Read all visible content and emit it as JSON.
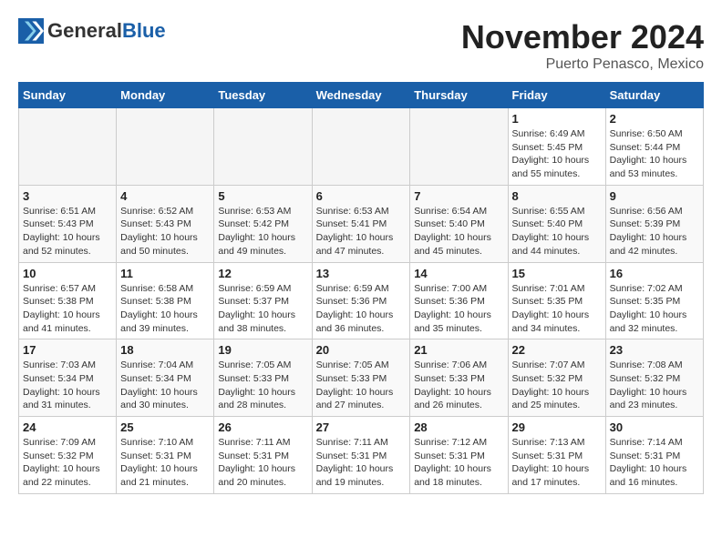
{
  "logo": {
    "text1": "General",
    "text2": "Blue"
  },
  "header": {
    "month": "November 2024",
    "location": "Puerto Penasco, Mexico"
  },
  "weekdays": [
    "Sunday",
    "Monday",
    "Tuesday",
    "Wednesday",
    "Thursday",
    "Friday",
    "Saturday"
  ],
  "weeks": [
    [
      {
        "day": "",
        "info": ""
      },
      {
        "day": "",
        "info": ""
      },
      {
        "day": "",
        "info": ""
      },
      {
        "day": "",
        "info": ""
      },
      {
        "day": "",
        "info": ""
      },
      {
        "day": "1",
        "sunrise": "Sunrise: 6:49 AM",
        "sunset": "Sunset: 5:45 PM",
        "daylight": "Daylight: 10 hours and 55 minutes."
      },
      {
        "day": "2",
        "sunrise": "Sunrise: 6:50 AM",
        "sunset": "Sunset: 5:44 PM",
        "daylight": "Daylight: 10 hours and 53 minutes."
      }
    ],
    [
      {
        "day": "3",
        "sunrise": "Sunrise: 6:51 AM",
        "sunset": "Sunset: 5:43 PM",
        "daylight": "Daylight: 10 hours and 52 minutes."
      },
      {
        "day": "4",
        "sunrise": "Sunrise: 6:52 AM",
        "sunset": "Sunset: 5:43 PM",
        "daylight": "Daylight: 10 hours and 50 minutes."
      },
      {
        "day": "5",
        "sunrise": "Sunrise: 6:53 AM",
        "sunset": "Sunset: 5:42 PM",
        "daylight": "Daylight: 10 hours and 49 minutes."
      },
      {
        "day": "6",
        "sunrise": "Sunrise: 6:53 AM",
        "sunset": "Sunset: 5:41 PM",
        "daylight": "Daylight: 10 hours and 47 minutes."
      },
      {
        "day": "7",
        "sunrise": "Sunrise: 6:54 AM",
        "sunset": "Sunset: 5:40 PM",
        "daylight": "Daylight: 10 hours and 45 minutes."
      },
      {
        "day": "8",
        "sunrise": "Sunrise: 6:55 AM",
        "sunset": "Sunset: 5:40 PM",
        "daylight": "Daylight: 10 hours and 44 minutes."
      },
      {
        "day": "9",
        "sunrise": "Sunrise: 6:56 AM",
        "sunset": "Sunset: 5:39 PM",
        "daylight": "Daylight: 10 hours and 42 minutes."
      }
    ],
    [
      {
        "day": "10",
        "sunrise": "Sunrise: 6:57 AM",
        "sunset": "Sunset: 5:38 PM",
        "daylight": "Daylight: 10 hours and 41 minutes."
      },
      {
        "day": "11",
        "sunrise": "Sunrise: 6:58 AM",
        "sunset": "Sunset: 5:38 PM",
        "daylight": "Daylight: 10 hours and 39 minutes."
      },
      {
        "day": "12",
        "sunrise": "Sunrise: 6:59 AM",
        "sunset": "Sunset: 5:37 PM",
        "daylight": "Daylight: 10 hours and 38 minutes."
      },
      {
        "day": "13",
        "sunrise": "Sunrise: 6:59 AM",
        "sunset": "Sunset: 5:36 PM",
        "daylight": "Daylight: 10 hours and 36 minutes."
      },
      {
        "day": "14",
        "sunrise": "Sunrise: 7:00 AM",
        "sunset": "Sunset: 5:36 PM",
        "daylight": "Daylight: 10 hours and 35 minutes."
      },
      {
        "day": "15",
        "sunrise": "Sunrise: 7:01 AM",
        "sunset": "Sunset: 5:35 PM",
        "daylight": "Daylight: 10 hours and 34 minutes."
      },
      {
        "day": "16",
        "sunrise": "Sunrise: 7:02 AM",
        "sunset": "Sunset: 5:35 PM",
        "daylight": "Daylight: 10 hours and 32 minutes."
      }
    ],
    [
      {
        "day": "17",
        "sunrise": "Sunrise: 7:03 AM",
        "sunset": "Sunset: 5:34 PM",
        "daylight": "Daylight: 10 hours and 31 minutes."
      },
      {
        "day": "18",
        "sunrise": "Sunrise: 7:04 AM",
        "sunset": "Sunset: 5:34 PM",
        "daylight": "Daylight: 10 hours and 30 minutes."
      },
      {
        "day": "19",
        "sunrise": "Sunrise: 7:05 AM",
        "sunset": "Sunset: 5:33 PM",
        "daylight": "Daylight: 10 hours and 28 minutes."
      },
      {
        "day": "20",
        "sunrise": "Sunrise: 7:05 AM",
        "sunset": "Sunset: 5:33 PM",
        "daylight": "Daylight: 10 hours and 27 minutes."
      },
      {
        "day": "21",
        "sunrise": "Sunrise: 7:06 AM",
        "sunset": "Sunset: 5:33 PM",
        "daylight": "Daylight: 10 hours and 26 minutes."
      },
      {
        "day": "22",
        "sunrise": "Sunrise: 7:07 AM",
        "sunset": "Sunset: 5:32 PM",
        "daylight": "Daylight: 10 hours and 25 minutes."
      },
      {
        "day": "23",
        "sunrise": "Sunrise: 7:08 AM",
        "sunset": "Sunset: 5:32 PM",
        "daylight": "Daylight: 10 hours and 23 minutes."
      }
    ],
    [
      {
        "day": "24",
        "sunrise": "Sunrise: 7:09 AM",
        "sunset": "Sunset: 5:32 PM",
        "daylight": "Daylight: 10 hours and 22 minutes."
      },
      {
        "day": "25",
        "sunrise": "Sunrise: 7:10 AM",
        "sunset": "Sunset: 5:31 PM",
        "daylight": "Daylight: 10 hours and 21 minutes."
      },
      {
        "day": "26",
        "sunrise": "Sunrise: 7:11 AM",
        "sunset": "Sunset: 5:31 PM",
        "daylight": "Daylight: 10 hours and 20 minutes."
      },
      {
        "day": "27",
        "sunrise": "Sunrise: 7:11 AM",
        "sunset": "Sunset: 5:31 PM",
        "daylight": "Daylight: 10 hours and 19 minutes."
      },
      {
        "day": "28",
        "sunrise": "Sunrise: 7:12 AM",
        "sunset": "Sunset: 5:31 PM",
        "daylight": "Daylight: 10 hours and 18 minutes."
      },
      {
        "day": "29",
        "sunrise": "Sunrise: 7:13 AM",
        "sunset": "Sunset: 5:31 PM",
        "daylight": "Daylight: 10 hours and 17 minutes."
      },
      {
        "day": "30",
        "sunrise": "Sunrise: 7:14 AM",
        "sunset": "Sunset: 5:31 PM",
        "daylight": "Daylight: 10 hours and 16 minutes."
      }
    ]
  ]
}
